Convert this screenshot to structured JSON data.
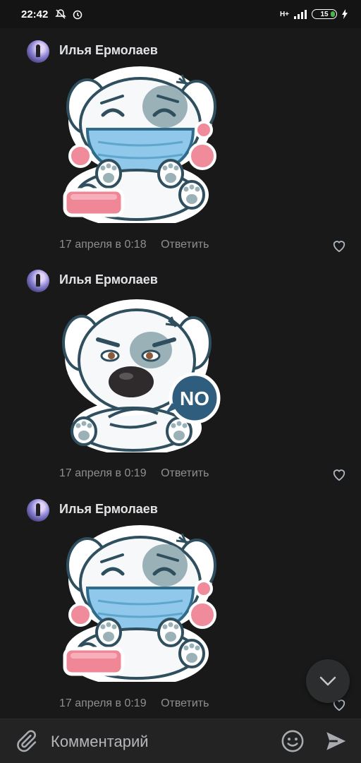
{
  "status_bar": {
    "time": "22:42",
    "battery": "15",
    "network": "H+"
  },
  "comments": [
    {
      "author": "Илья Ермолаев",
      "date": "17 апреля в 0:18",
      "reply": "Ответить",
      "sticker": "mask"
    },
    {
      "author": "Илья Ермолаев",
      "date": "17 апреля в 0:19",
      "reply": "Ответить",
      "sticker": "no",
      "sticker_text": "NO"
    },
    {
      "author": "Илья Ермолаев",
      "date": "17 апреля в 0:19",
      "reply": "Ответить",
      "sticker": "mask"
    }
  ],
  "composer": {
    "placeholder": "Комментарий"
  },
  "colors": {
    "background": "#191919",
    "bear_outline": "#2f5d6e",
    "mask": "#8fc8ea",
    "pink": "#f08b9b"
  }
}
